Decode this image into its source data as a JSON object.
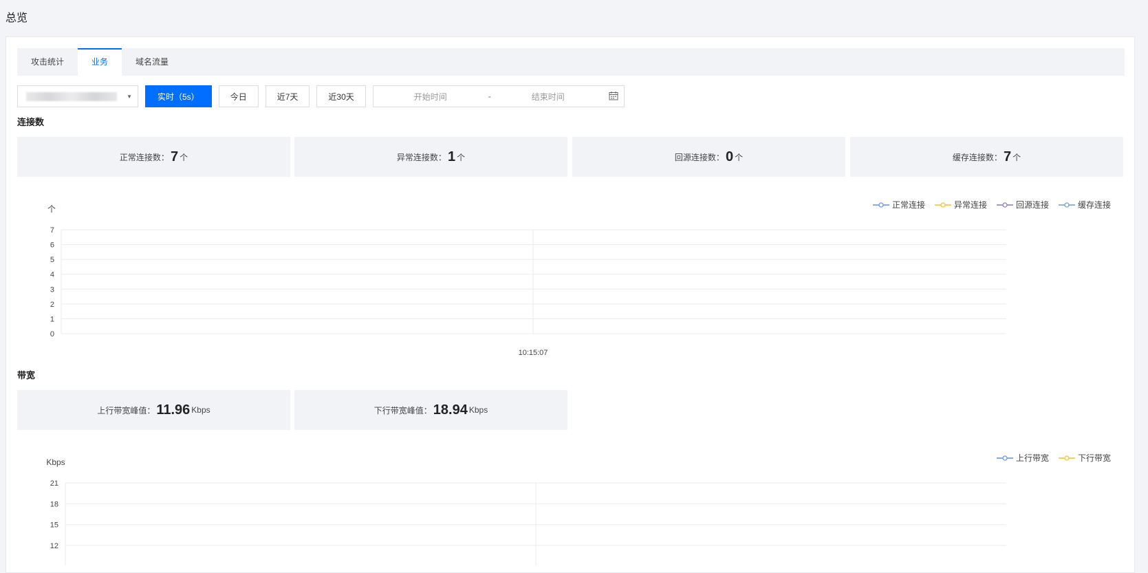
{
  "page": {
    "title": "总览"
  },
  "tabs": [
    {
      "label": "攻击统计",
      "active": false
    },
    {
      "label": "业务",
      "active": true
    },
    {
      "label": "域名流量",
      "active": false
    }
  ],
  "toolbar": {
    "buttons": [
      {
        "label": "实时（5s）",
        "primary": true
      },
      {
        "label": "今日",
        "primary": false
      },
      {
        "label": "近7天",
        "primary": false
      },
      {
        "label": "近30天",
        "primary": false
      }
    ],
    "date_start_placeholder": "开始时间",
    "date_separator": "-",
    "date_end_placeholder": "结束时间"
  },
  "connections": {
    "title": "连接数",
    "stats": [
      {
        "label": "正常连接数：",
        "value": "7",
        "unit": "个"
      },
      {
        "label": "异常连接数：",
        "value": "1",
        "unit": "个"
      },
      {
        "label": "回源连接数：",
        "value": "0",
        "unit": "个"
      },
      {
        "label": "缓存连接数：",
        "value": "7",
        "unit": "个"
      }
    ]
  },
  "bandwidth": {
    "title": "带宽",
    "stats": [
      {
        "label": "上行带宽峰值：",
        "value": "11.96",
        "unit": "Kbps"
      },
      {
        "label": "下行带宽峰值：",
        "value": "18.94",
        "unit": "Kbps"
      }
    ]
  },
  "chart_data": [
    {
      "type": "line",
      "ylabel": "个",
      "ylim": [
        0,
        7
      ],
      "yticks": [
        0,
        1,
        2,
        3,
        4,
        5,
        6,
        7
      ],
      "x": [
        "10:15:07"
      ],
      "grid": true,
      "legend_position": "top-right",
      "series": [
        {
          "name": "正常连接",
          "color": "#5b8ff9",
          "values": []
        },
        {
          "name": "异常连接",
          "color": "#f6c022",
          "values": []
        },
        {
          "name": "回源连接",
          "color": "#9270ca",
          "values": []
        },
        {
          "name": "缓存连接",
          "color": "#6b9bd6",
          "values": []
        }
      ]
    },
    {
      "type": "line",
      "ylabel": "Kbps",
      "ylim": [
        0,
        21
      ],
      "yticks": [
        12,
        15,
        18,
        21
      ],
      "x": [],
      "grid": true,
      "legend_position": "top-right",
      "series": [
        {
          "name": "上行带宽",
          "color": "#5b8ff9",
          "values": []
        },
        {
          "name": "下行带宽",
          "color": "#f6c022",
          "values": []
        }
      ]
    }
  ]
}
